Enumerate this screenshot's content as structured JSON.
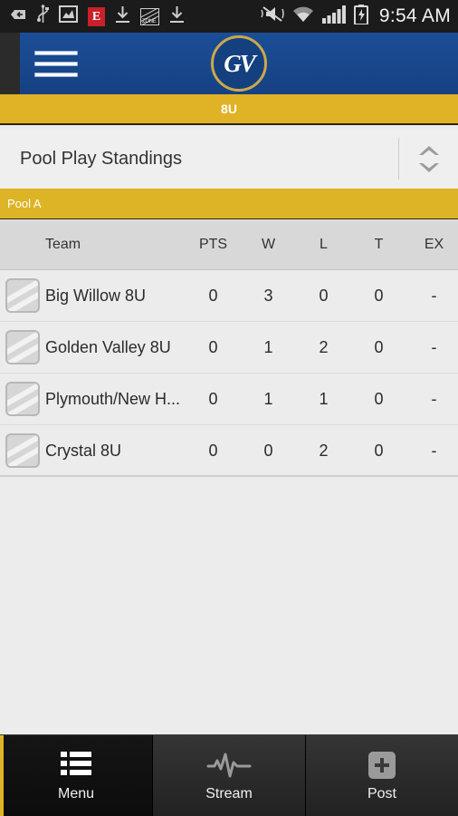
{
  "statusbar": {
    "time": "9:54 AM",
    "left_icons": [
      "back-sdcard-icon",
      "usb-icon",
      "screenshot-icon",
      "e-app-icon",
      "download-icon",
      "zone-app-icon",
      "download-icon-2"
    ],
    "right_icons": [
      "mute-vibrate-icon",
      "wifi-icon",
      "signal-icon",
      "battery-charging-icon"
    ],
    "e_icon_label": "E",
    "zone_icon_label": "ZONE"
  },
  "actionbar": {
    "menu_icon": "hamburger-icon",
    "logo_text": "GV",
    "logo_name": "gv-team-logo",
    "bg_color": "#17478c",
    "accent_color": "#c9a84c"
  },
  "subbar": {
    "text": "8U",
    "bg_color": "#e0b225"
  },
  "spinner": {
    "label": "Pool Play Standings",
    "icon": "chevron-up-down-icon"
  },
  "pool_header": {
    "text": "Pool A",
    "bg_color": "#ddb426"
  },
  "table": {
    "columns": [
      "Team",
      "PTS",
      "W",
      "L",
      "T",
      "EX"
    ],
    "rows": [
      {
        "icon": "team-placeholder-icon",
        "team": "Big Willow 8U",
        "pts": "0",
        "w": "3",
        "l": "0",
        "t": "0",
        "ex": "-"
      },
      {
        "icon": "team-placeholder-icon",
        "team": "Golden Valley 8U",
        "pts": "0",
        "w": "1",
        "l": "2",
        "t": "0",
        "ex": "-"
      },
      {
        "icon": "team-placeholder-icon",
        "team": "Plymouth/New H...",
        "pts": "0",
        "w": "1",
        "l": "1",
        "t": "0",
        "ex": "-"
      },
      {
        "icon": "team-placeholder-icon",
        "team": "Crystal 8U",
        "pts": "0",
        "w": "0",
        "l": "2",
        "t": "0",
        "ex": "-"
      }
    ]
  },
  "tabbar": {
    "tabs": [
      {
        "label": "Menu",
        "icon": "list-icon",
        "selected": true
      },
      {
        "label": "Stream",
        "icon": "pulse-icon",
        "selected": false
      },
      {
        "label": "Post",
        "icon": "plus-icon",
        "selected": false
      }
    ],
    "accent_color": "#e0b225"
  }
}
